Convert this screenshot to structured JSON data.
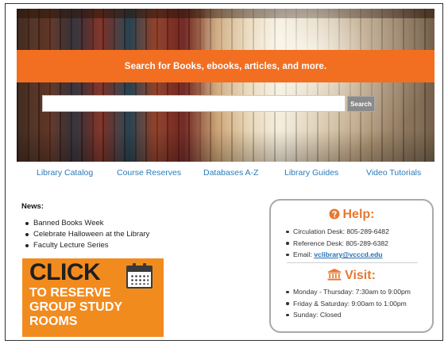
{
  "hero": {
    "banner_text": "Search for Books, ebooks, articles, and more.",
    "search_placeholder": "",
    "search_button_label": "Search"
  },
  "nav": {
    "links": [
      {
        "label": "Library Catalog"
      },
      {
        "label": "Course Reserves"
      },
      {
        "label": "Databases A-Z"
      },
      {
        "label": "Library Guides"
      },
      {
        "label": "Video Tutorials"
      }
    ]
  },
  "news": {
    "title": "News:",
    "items": [
      {
        "label": "Banned Books Week"
      },
      {
        "label": "Celebrate Halloween at the Library"
      },
      {
        "label": "Faculty Lecture Series"
      }
    ]
  },
  "promo": {
    "line1": "CLICK",
    "line2": "TO RESERVE",
    "line3": "GROUP STUDY",
    "line4": "ROOMS",
    "icon": "calendar-icon"
  },
  "help": {
    "title": "Help:",
    "icon": "question-circle-icon",
    "items": [
      {
        "label": "Circulation Desk: 805-289-6482"
      },
      {
        "label": "Reference Desk: 805-289-6382"
      }
    ],
    "email_label": "Email: ",
    "email_link": "vclibrary@vcccd.edu"
  },
  "visit": {
    "title": "Visit:",
    "icon": "building-columns-icon",
    "hours": [
      {
        "label": "Monday - Thursday: 7:30am to 9:00pm"
      },
      {
        "label": "Friday & Saturday: 9:00am to 1:00pm"
      },
      {
        "label": "Sunday: Closed"
      }
    ]
  },
  "colors": {
    "accent_orange": "#f26f22",
    "promo_orange": "#f28b1e",
    "link_blue": "#2a7bb8",
    "heading_orange": "#e8772e"
  }
}
